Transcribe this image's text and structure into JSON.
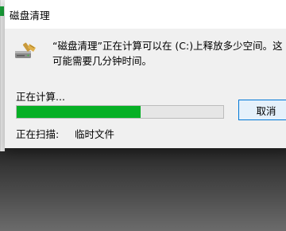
{
  "window": {
    "title": "磁盘清理"
  },
  "message": {
    "text": "“磁盘清理”正在计算可以在 (C:)上释放多少空间。这可能需要几分钟时间。"
  },
  "status": {
    "text": "正在计算..."
  },
  "progress": {
    "percent": 60,
    "color": "#06b025"
  },
  "scan": {
    "label": "正在扫描:",
    "value": "临时文件"
  },
  "buttons": {
    "cancel": "取消"
  },
  "icons": {
    "app": "disk-cleanup-icon"
  }
}
